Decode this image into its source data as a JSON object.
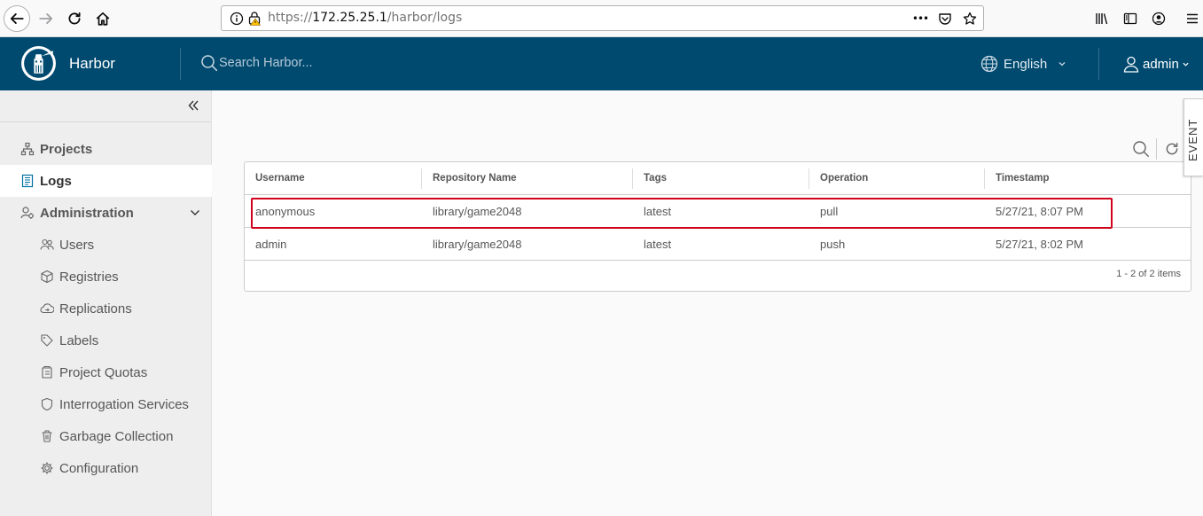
{
  "browser": {
    "url_prefix": "https://",
    "url_host": "172.25.25.1",
    "url_path": "/harbor/logs",
    "more_label": "•••"
  },
  "header": {
    "brand": "Harbor",
    "search_placeholder": "Search Harbor...",
    "language": "English",
    "user": "admin",
    "bg_color": "#004a70"
  },
  "sidebar": {
    "items": [
      {
        "label": "Projects",
        "icon": "projects-icon"
      },
      {
        "label": "Logs",
        "icon": "logs-icon"
      },
      {
        "label": "Administration",
        "icon": "administration-icon"
      },
      {
        "label": "Users",
        "icon": "users-icon"
      },
      {
        "label": "Registries",
        "icon": "registries-icon"
      },
      {
        "label": "Replications",
        "icon": "replications-icon"
      },
      {
        "label": "Labels",
        "icon": "labels-icon"
      },
      {
        "label": "Project Quotas",
        "icon": "project-quotas-icon"
      },
      {
        "label": "Interrogation Services",
        "icon": "interrogation-icon"
      },
      {
        "label": "Garbage Collection",
        "icon": "garbage-collection-icon"
      },
      {
        "label": "Configuration",
        "icon": "configuration-icon"
      }
    ]
  },
  "event_tab": "EVENT",
  "logs": {
    "columns": [
      "Username",
      "Repository Name",
      "Tags",
      "Operation",
      "Timestamp"
    ],
    "rows": [
      {
        "username": "anonymous",
        "repository": "library/game2048",
        "tags": "latest",
        "operation": "pull",
        "timestamp": "5/27/21, 8:07 PM"
      },
      {
        "username": "admin",
        "repository": "library/game2048",
        "tags": "latest",
        "operation": "push",
        "timestamp": "5/27/21, 8:02 PM"
      }
    ],
    "footer": "1 - 2 of 2 items",
    "highlight_color": "#d0021b"
  }
}
